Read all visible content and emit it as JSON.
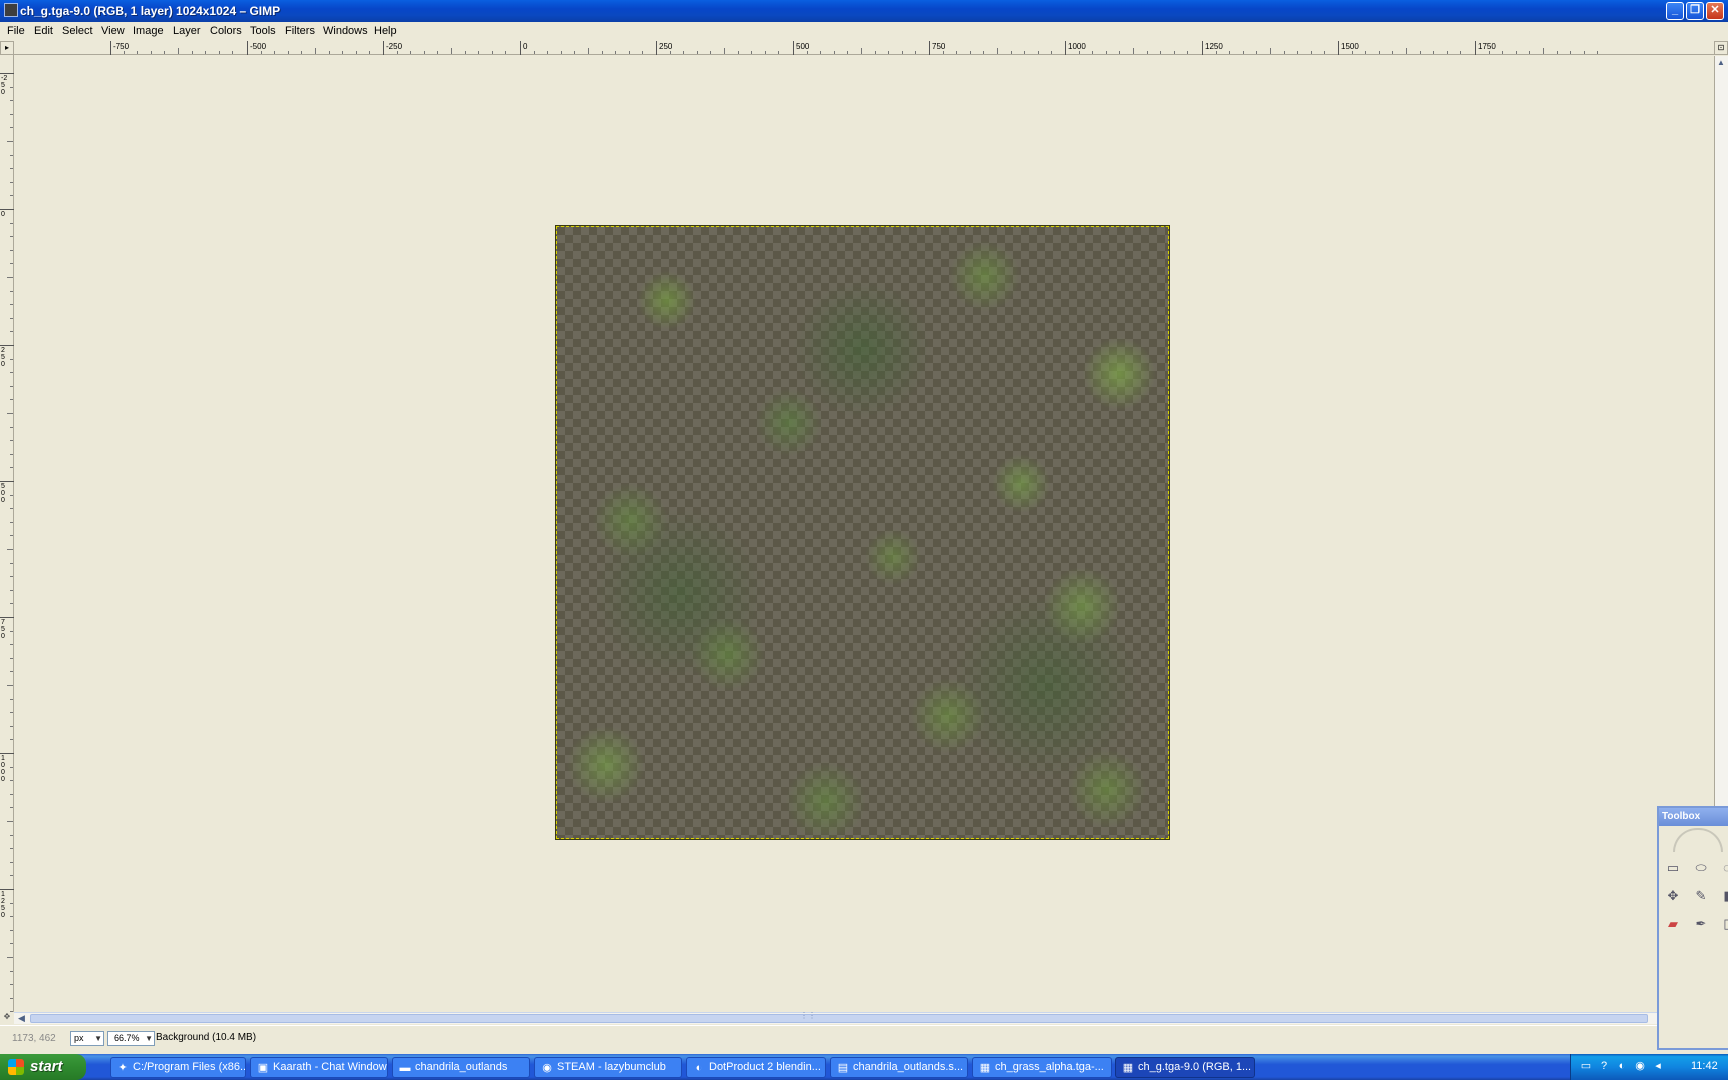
{
  "window": {
    "title": "ch_g.tga-9.0 (RGB, 1 layer) 1024x1024 – GIMP",
    "minimize": "_",
    "maximize": "❐",
    "close": "✕"
  },
  "menu": [
    "File",
    "Edit",
    "Select",
    "View",
    "Image",
    "Layer",
    "Colors",
    "Tools",
    "Filters",
    "Windows",
    "Help"
  ],
  "hruler": {
    "ticks": [
      "-750",
      "-500",
      "-250",
      "0",
      "250",
      "500",
      "750",
      "1000",
      "1250",
      "1500",
      "1750"
    ]
  },
  "vruler": {
    "ticks": [
      "-250",
      "0",
      "250",
      "500",
      "750",
      "1000",
      "1250"
    ]
  },
  "statusbar": {
    "coords": "1173, 462",
    "unit": "px",
    "zoom": "66.7%",
    "layer_info": "Background (10.4 MB)"
  },
  "toolbox": {
    "title": "Toolbox",
    "tools": [
      "rect-select-icon",
      "ellipse-select-icon",
      "free-select-icon",
      "move-icon",
      "paths-icon",
      "clone-icon",
      "eraser-icon",
      "color-picker-icon",
      "measure-icon"
    ]
  },
  "taskbar": {
    "start": "start",
    "tasks": [
      {
        "label": "C:/Program Files (x86...",
        "icon": "gimp-icon"
      },
      {
        "label": "Kaarath - Chat Window",
        "icon": "chat-icon"
      },
      {
        "label": "chandrila_outlands",
        "icon": "folder-icon"
      },
      {
        "label": "STEAM - lazybumclub",
        "icon": "steam-icon"
      },
      {
        "label": "DotProduct 2 blendin...",
        "icon": "firefox-icon"
      },
      {
        "label": "chandrila_outlands.s...",
        "icon": "document-icon"
      },
      {
        "label": "ch_grass_alpha.tga-...",
        "icon": "image-icon"
      },
      {
        "label": "ch_g.tga-9.0 (RGB, 1...",
        "icon": "image-icon"
      }
    ],
    "clock": "11:42"
  }
}
